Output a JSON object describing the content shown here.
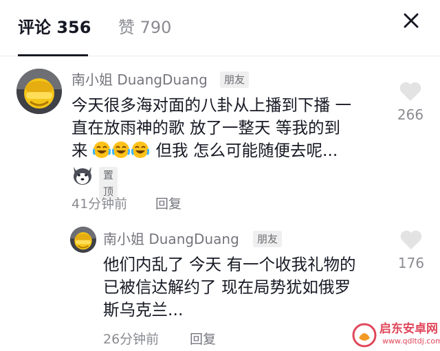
{
  "tabs": {
    "comments_label": "评论 356",
    "likes_label": "赞 790"
  },
  "icons": {
    "close": "close-icon",
    "heart": "heart-icon",
    "laugh_cry": "laughing-crying-emoji-icon",
    "husky": "husky-avatar-icon",
    "logo": "quandong-anzhuo-logo-icon"
  },
  "colors": {
    "text_primary": "#161823",
    "text_secondary": "#8a8b91",
    "badge_bg": "#efefef",
    "heart": "#e3e3e3"
  },
  "comments": [
    {
      "author": "南小姐 DuangDuang",
      "badge": "朋友",
      "lines": [
        "今天很多海对面的八卦从上播到下播 一",
        "直在放雨神的歌 放了一整天 等我的到",
        "来",
        "但我 怎么可能随便去呢..."
      ],
      "emoji_count": 3,
      "pin_label": "置顶",
      "time": "41分钟前",
      "reply_label": "回复",
      "likes": "266"
    },
    {
      "author": "南小姐 DuangDuang",
      "badge": "朋友",
      "lines": [
        "他们内乱了 今天 有一个收我礼物的",
        "已被信达解约了 现在局势犹如俄罗",
        "斯乌克兰..."
      ],
      "time": "26分钟前",
      "reply_label": "回复",
      "likes": "176"
    }
  ],
  "watermark": {
    "name": "启东安卓网",
    "url": "www.qdltdj.com"
  }
}
